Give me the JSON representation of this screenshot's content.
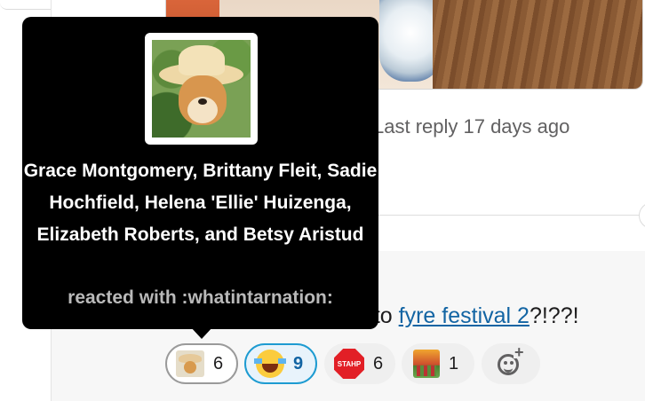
{
  "thread": {
    "reply_meta": "Last reply 17 days ago"
  },
  "message": {
    "text_visible_prefix": "g to ",
    "link_text": "fyre festival 2",
    "text_suffix": "?!??!"
  },
  "reactions": [
    {
      "emoji": "whatintarnation",
      "count": "6",
      "selected": false
    },
    {
      "emoji": "joy",
      "count": "9",
      "selected": true
    },
    {
      "emoji": "stahp",
      "count": "6",
      "selected": false
    },
    {
      "emoji": "dumpster-fire",
      "count": "1",
      "selected": false
    }
  ],
  "add_reaction": {
    "icon": "add-reaction-icon"
  },
  "tooltip": {
    "names": "Grace Montgomery, Brittany Fleit, Sadie Hochfield, Helena 'Ellie' Huizenga, Elizabeth Roberts, and Betsy Aristud",
    "action": "reacted with :whatintarnation:"
  },
  "colors": {
    "link": "#1264a3",
    "selected_reaction_border": "#1d9bd1",
    "tooltip_bg": "#000000"
  }
}
